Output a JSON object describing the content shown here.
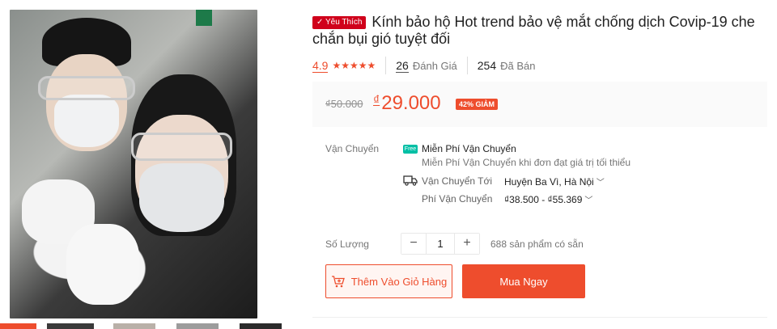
{
  "product": {
    "badge": "Yêu Thích",
    "title": "Kính bảo hộ Hot trend bảo vệ mắt chống dịch Covip-19 che chắn bụi gió tuyệt đối"
  },
  "rating": {
    "value": "4.9",
    "stars": "★★★★★",
    "reviews_count": "26",
    "reviews_label": "Đánh Giá",
    "sold_count": "254",
    "sold_label": "Đã Bán"
  },
  "price": {
    "original": "₫50.000",
    "currency": "₫",
    "current": "29.000",
    "discount": "42% GIẢM"
  },
  "shipping": {
    "label": "Vận Chuyển",
    "free_icon_text": "Free",
    "free_title": "Miễn Phí Vận Chuyển",
    "free_sub": "Miễn Phí Vận Chuyển khi đơn đạt giá trị tối thiểu",
    "to_label": "Vận Chuyển Tới",
    "to_value": "Huyện Ba Vì, Hà Nội",
    "fee_label": "Phí Vận Chuyển",
    "fee_value": "₫38.500 - ₫55.369"
  },
  "quantity": {
    "label": "Số Lượng",
    "minus": "−",
    "value": "1",
    "plus": "+",
    "stock": "688 sản phẩm có sẵn"
  },
  "actions": {
    "add_to_cart": "Thêm Vào Giỏ Hàng",
    "buy_now": "Mua Ngay"
  },
  "colors": {
    "accent": "#ee4d2d",
    "badge": "#d0011b",
    "free_ship": "#00bfa5"
  }
}
